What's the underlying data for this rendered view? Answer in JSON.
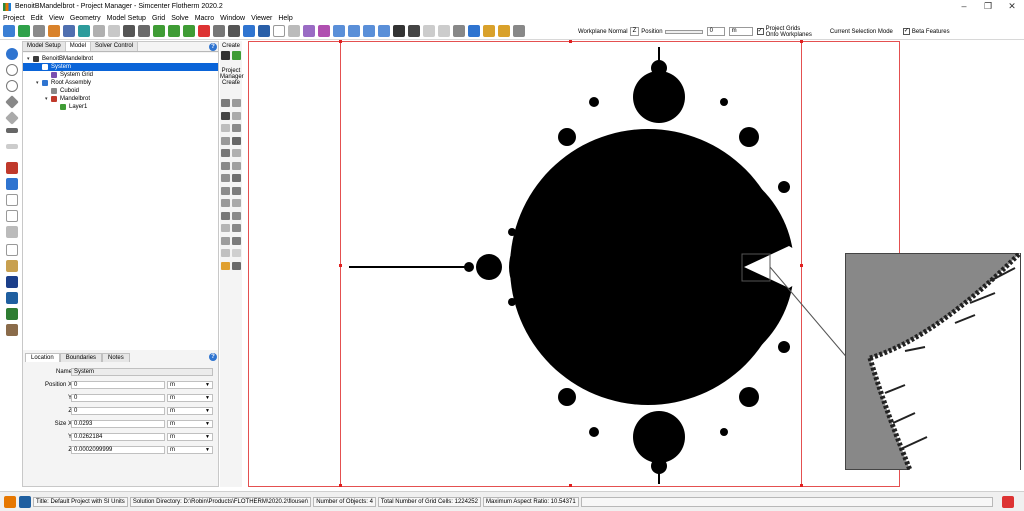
{
  "window": {
    "title": "BenoitBMandelbrot - Project Manager - Simcenter Flotherm 2020.2",
    "minimize": "–",
    "maximize": "❐",
    "close": "✕"
  },
  "menu": [
    "Project",
    "Edit",
    "View",
    "Geometry",
    "Model Setup",
    "Grid",
    "Solve",
    "Macro",
    "Window",
    "Viewer",
    "Help"
  ],
  "toolbar": {
    "workplane_normal_label": "Workplane Normal",
    "workplane_normal_value": "Z",
    "position_label": "Position",
    "position_value": "0",
    "position_unit": "m",
    "project_grids_line1": "Project Grids",
    "project_grids_line2": "Onto Workplanes",
    "current_selection_mode": "Current Selection Mode",
    "beta_features": "Beta Features"
  },
  "panel": {
    "tabs": [
      "Model Setup",
      "Model",
      "Solver Control"
    ],
    "active_tab": "Model",
    "tree": [
      {
        "label": "BenoitBMandelbrot",
        "depth": 0,
        "arrow": "▾",
        "icon": "project-icon",
        "color": "#3a3a3a"
      },
      {
        "label": "System",
        "depth": 1,
        "arrow": "",
        "icon": "system-icon",
        "color": "#ffffff",
        "selected": true
      },
      {
        "label": "System Grid",
        "depth": 2,
        "arrow": "",
        "icon": "grid-icon",
        "color": "#7a4fb0"
      },
      {
        "label": "Root Assembly",
        "depth": 1,
        "arrow": "▾",
        "icon": "assembly-icon",
        "color": "#2f74d0"
      },
      {
        "label": "Cuboid",
        "depth": 2,
        "arrow": "",
        "icon": "cuboid-icon",
        "color": "#8a8a8a"
      },
      {
        "label": "Mandelbrot",
        "depth": 2,
        "arrow": "▾",
        "icon": "mandelbrot-icon",
        "color": "#c0392b"
      },
      {
        "label": "Layer1",
        "depth": 3,
        "arrow": "",
        "icon": "layer-icon",
        "color": "#3f9c35"
      }
    ]
  },
  "properties": {
    "tabs": [
      "Location",
      "Boundaries",
      "Notes"
    ],
    "active_tab": "Location",
    "name_label": "Name",
    "name_value": "System",
    "rows": [
      {
        "label": "Position X",
        "value": "0",
        "unit": "m"
      },
      {
        "label": "Y",
        "value": "0",
        "unit": "m"
      },
      {
        "label": "Z",
        "value": "0",
        "unit": "m"
      },
      {
        "label": "Size X",
        "value": "0.0293",
        "unit": "m"
      },
      {
        "label": "Y",
        "value": "0.0262184",
        "unit": "m"
      },
      {
        "label": "Z",
        "value": "0.0002099999",
        "unit": "m"
      }
    ]
  },
  "create": {
    "label": "Create",
    "pm_line1": "Project",
    "pm_line2": "Manager",
    "pm_line3": "Create"
  },
  "status": {
    "title": "Title: Default Project with SI Units",
    "solution_dir": "Solution Directory: D:\\Robin\\Products\\FLOTHERM\\2020.2\\flouser\\",
    "objects": "Number of Objects: 4",
    "grid_cells": "Total Number of Grid Cells: 1224252",
    "aspect_ratio": "Maximum Aspect Ratio: 10.54371"
  },
  "colors": {
    "selection": "#0a64d8",
    "viewport_border": "#e45050",
    "fractal": "#000000",
    "zoom_background": "#888888"
  }
}
